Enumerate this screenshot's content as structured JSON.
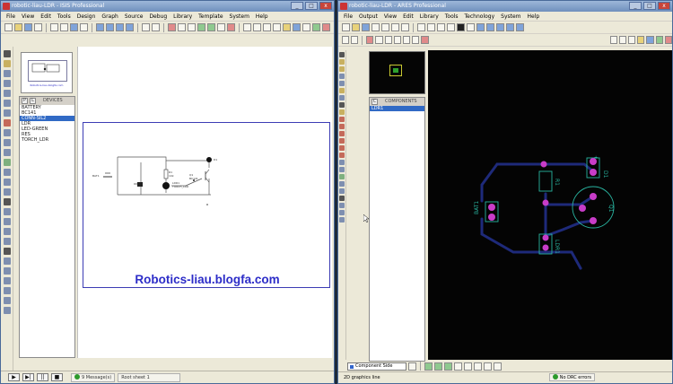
{
  "isis": {
    "title": "robotic-liau-LDR - ISIS Professional",
    "menu": [
      "File",
      "View",
      "Edit",
      "Tools",
      "Design",
      "Graph",
      "Source",
      "Debug",
      "Library",
      "Template",
      "System",
      "Help"
    ],
    "panel_tab_p": "P",
    "panel_tab_l": "L",
    "panel_title": "DEVICES",
    "devices": [
      "BATTERY",
      "BC141",
      "CONN-SIL2",
      "LDR",
      "LED-GREEN",
      "RES",
      "TORCH_LDR"
    ],
    "selected_device": "CONN-SIL2",
    "overview_caption": "Robotics-liau.blogfa.com",
    "watermark": "Robotics-liau.blogfa.com",
    "status_messages": "9 Message(s)",
    "status_sheet": "Root sheet 1",
    "play_controls": [
      "▶",
      "▶|",
      "||",
      "■"
    ],
    "parts": {
      "d1": "D1",
      "q1": "Q1",
      "q1_type": "BC141",
      "r1": "R1",
      "r1_val": "10k",
      "ldr": "LDR1",
      "ldr_type": "TORCH_LDR",
      "bat": "BAT1"
    }
  },
  "ares": {
    "title": "robotic-liau-LDR - ARES Professional",
    "menu": [
      "File",
      "Output",
      "View",
      "Edit",
      "Library",
      "Tools",
      "Technology",
      "System",
      "Help"
    ],
    "panel_tab": "C",
    "panel_title": "COMPONENTS",
    "components": [
      "LDR1"
    ],
    "selected_component": "LDR1",
    "layer": "Component Side",
    "status_graphics": "2D graphics line",
    "drc": "No DRC errors",
    "labels": {
      "d1": "D1",
      "q1": "Q1",
      "r1": "R1",
      "bat1": "BAT1",
      "ldr1": "LDR1"
    }
  },
  "colors": {
    "track": "#1e2a7a",
    "pad": "#c83cc8",
    "silk": "#29b4a0",
    "board_bg": "#040404",
    "watermark": "#2d2dc8",
    "selection": "#316ac5"
  }
}
